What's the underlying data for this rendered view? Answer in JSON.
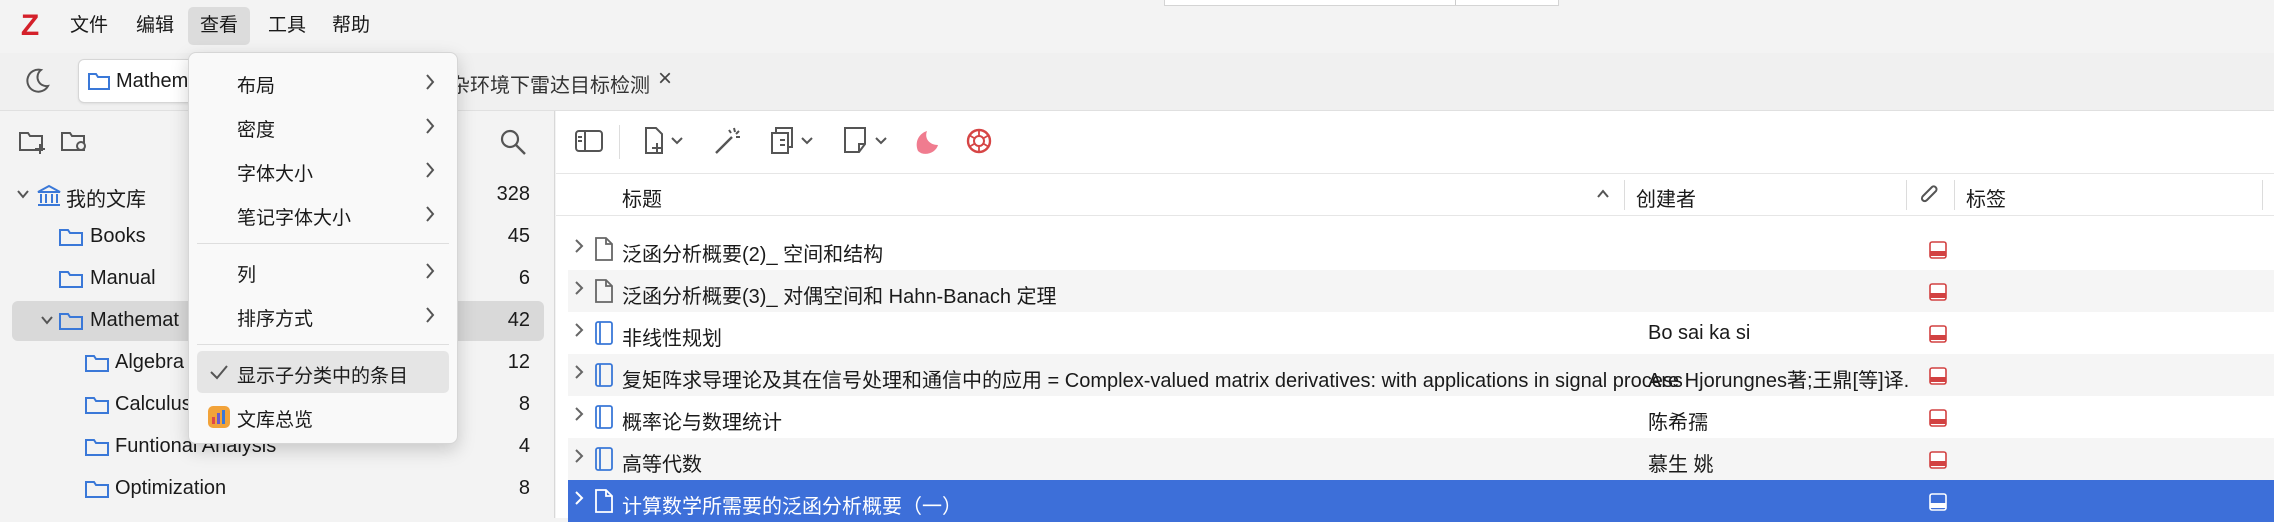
{
  "app": {
    "logo": "Z",
    "brand_color": "#d4202a"
  },
  "menubar": {
    "items": [
      {
        "label": "文件"
      },
      {
        "label": "编辑"
      },
      {
        "label": "查看"
      },
      {
        "label": "工具"
      },
      {
        "label": "帮助"
      }
    ],
    "active": "查看"
  },
  "tabs": {
    "library_tab": "Mathem",
    "doc_tab": "杂环境下雷达目标检测"
  },
  "sidebar": {
    "items": [
      {
        "label": "我的文库",
        "count": "328"
      },
      {
        "label": "Books",
        "count": "45"
      },
      {
        "label": "Manual",
        "count": "6"
      },
      {
        "label": "Mathemat",
        "count": "42"
      },
      {
        "label": "Algebra",
        "count": "12"
      },
      {
        "label": "Calculus",
        "count": "8"
      },
      {
        "label": "Funtional Analysis",
        "count": "4"
      },
      {
        "label": "Optimization",
        "count": "8"
      }
    ]
  },
  "columns": {
    "title": "标题",
    "creator": "创建者",
    "tags": "标签"
  },
  "items": [
    {
      "title": "泛函分析概要(2)_ 空间和结构",
      "creator": "",
      "type": "document-icon"
    },
    {
      "title": "泛函分析概要(3)_ 对偶空间和 Hahn-Banach 定理",
      "creator": "",
      "type": "document-icon"
    },
    {
      "title": "非线性规划",
      "creator": "Bo sai ka si",
      "type": "book-icon"
    },
    {
      "title": "复矩阵求导理论及其在信号处理和通信中的应用 = Complex-valued matrix derivatives: with applications in signal processing and communications",
      "creator": "Are Hjorungnes著;王鼎[等]译.",
      "type": "book-icon"
    },
    {
      "title": "概率论与数理统计",
      "creator": "陈希孺",
      "type": "book-icon"
    },
    {
      "title": "高等代数",
      "creator": "慕生 姚",
      "type": "book-icon"
    },
    {
      "title": "计算数学所需要的泛函分析概要（一）",
      "creator": "",
      "type": "document-icon",
      "selected": true
    }
  ],
  "view_menu": {
    "items": [
      {
        "label": "布局",
        "submenu": true
      },
      {
        "label": "密度",
        "submenu": true
      },
      {
        "label": "字体大小",
        "submenu": true
      },
      {
        "label": "笔记字体大小",
        "submenu": true
      },
      {
        "label": "列",
        "submenu": true
      },
      {
        "label": "排序方式",
        "submenu": true
      },
      {
        "label": "显示子分类中的条目",
        "checked": true
      },
      {
        "label": "文库总览"
      }
    ]
  },
  "colors": {
    "selection": "#3d6fd9",
    "folder": "#3a78d8",
    "pdf": "#d24141"
  }
}
